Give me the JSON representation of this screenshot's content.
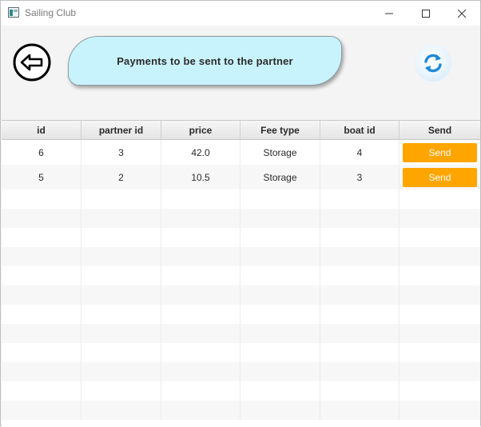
{
  "window": {
    "title": "Sailing Club"
  },
  "header": {
    "title": "Payments to be sent to the partner"
  },
  "icons": {
    "back": "arrow-left-circle-icon",
    "refresh": "refresh-icon"
  },
  "colors": {
    "title_pill": "#c9f3fc",
    "send_button": "#ffa500",
    "refresh_arrows": "#1e88d8"
  },
  "table": {
    "columns": [
      "id",
      "partner id",
      "price",
      "Fee type",
      "boat id",
      "Send"
    ],
    "rows": [
      {
        "id": "6",
        "partner_id": "3",
        "price": "42.0",
        "fee_type": "Storage",
        "boat_id": "4",
        "send_label": "Send"
      },
      {
        "id": "5",
        "partner_id": "2",
        "price": "10.5",
        "fee_type": "Storage",
        "boat_id": "3",
        "send_label": "Send"
      }
    ]
  }
}
